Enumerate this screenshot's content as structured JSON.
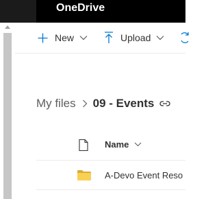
{
  "app": {
    "title": "OneDrive"
  },
  "commandbar": {
    "new_label": "New",
    "upload_label": "Upload"
  },
  "breadcrumb": {
    "root": "My files",
    "current": "09 - Events"
  },
  "list": {
    "columns": {
      "name": "Name"
    },
    "rows": [
      {
        "name": "A-Devo Event Reso",
        "type": "folder"
      }
    ]
  },
  "colors": {
    "accent": "#0078d4",
    "folder": "#f8d053",
    "topbar": "#000000"
  }
}
